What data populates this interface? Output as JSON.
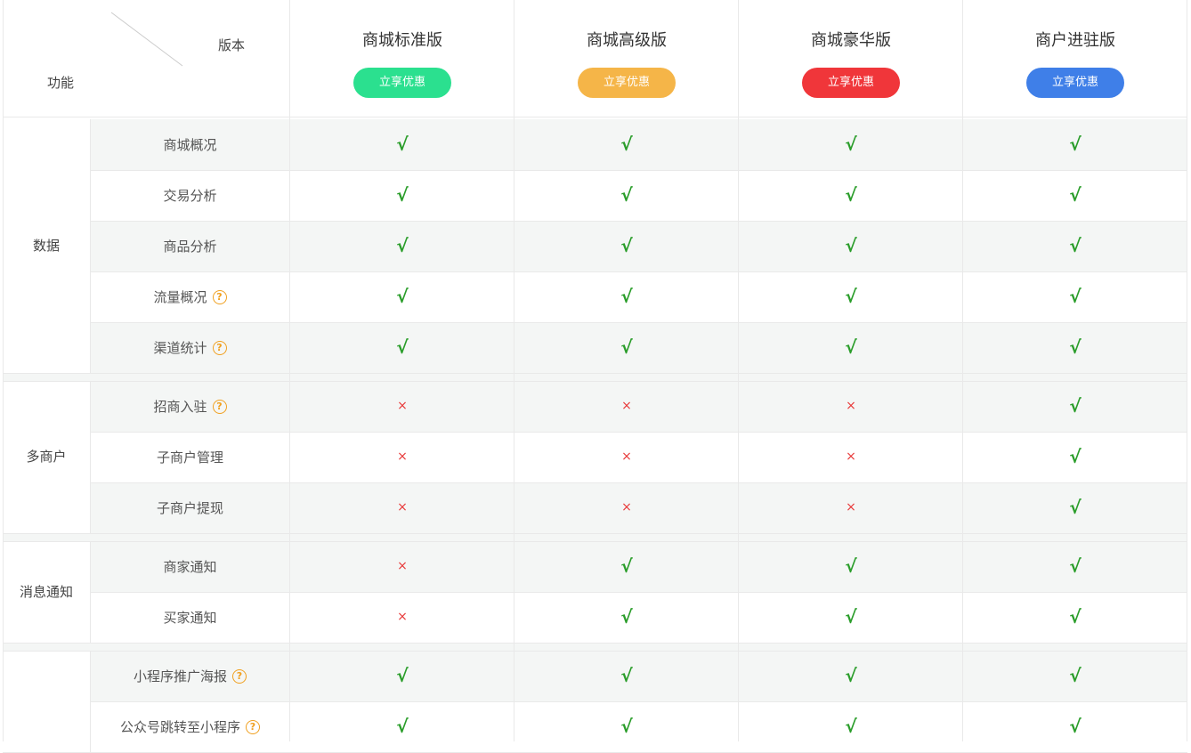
{
  "header": {
    "feature_label": "功能",
    "version_label": "版本",
    "plans": [
      {
        "name": "商城标准版",
        "button": "立享优惠",
        "color": "#2be08f"
      },
      {
        "name": "商城高级版",
        "button": "立享优惠",
        "color": "#f5b548"
      },
      {
        "name": "商城豪华版",
        "button": "立享优惠",
        "color": "#f0363a"
      },
      {
        "name": "商户进驻版",
        "button": "立享优惠",
        "color": "#3f7fe8"
      }
    ]
  },
  "symbols": {
    "yes": "√",
    "no": "×",
    "help": "?"
  },
  "groups": [
    {
      "category": "数据",
      "rows": [
        {
          "feature": "商城概况",
          "help": false,
          "values": [
            true,
            true,
            true,
            true
          ]
        },
        {
          "feature": "交易分析",
          "help": false,
          "values": [
            true,
            true,
            true,
            true
          ]
        },
        {
          "feature": "商品分析",
          "help": false,
          "values": [
            true,
            true,
            true,
            true
          ]
        },
        {
          "feature": "流量概况",
          "help": true,
          "values": [
            true,
            true,
            true,
            true
          ]
        },
        {
          "feature": "渠道统计",
          "help": true,
          "values": [
            true,
            true,
            true,
            true
          ]
        }
      ]
    },
    {
      "category": "多商户",
      "rows": [
        {
          "feature": "招商入驻",
          "help": true,
          "values": [
            false,
            false,
            false,
            true
          ]
        },
        {
          "feature": "子商户管理",
          "help": false,
          "values": [
            false,
            false,
            false,
            true
          ]
        },
        {
          "feature": "子商户提现",
          "help": false,
          "values": [
            false,
            false,
            false,
            true
          ]
        }
      ]
    },
    {
      "category": "消息通知",
      "rows": [
        {
          "feature": "商家通知",
          "help": false,
          "values": [
            false,
            true,
            true,
            true
          ]
        },
        {
          "feature": "买家通知",
          "help": false,
          "values": [
            false,
            true,
            true,
            true
          ]
        }
      ]
    },
    {
      "category": "",
      "rows": [
        {
          "feature": "小程序推广海报",
          "help": true,
          "values": [
            true,
            true,
            true,
            true
          ]
        },
        {
          "feature": "公众号跳转至小程序",
          "help": true,
          "values": [
            true,
            true,
            true,
            true
          ]
        }
      ]
    }
  ]
}
